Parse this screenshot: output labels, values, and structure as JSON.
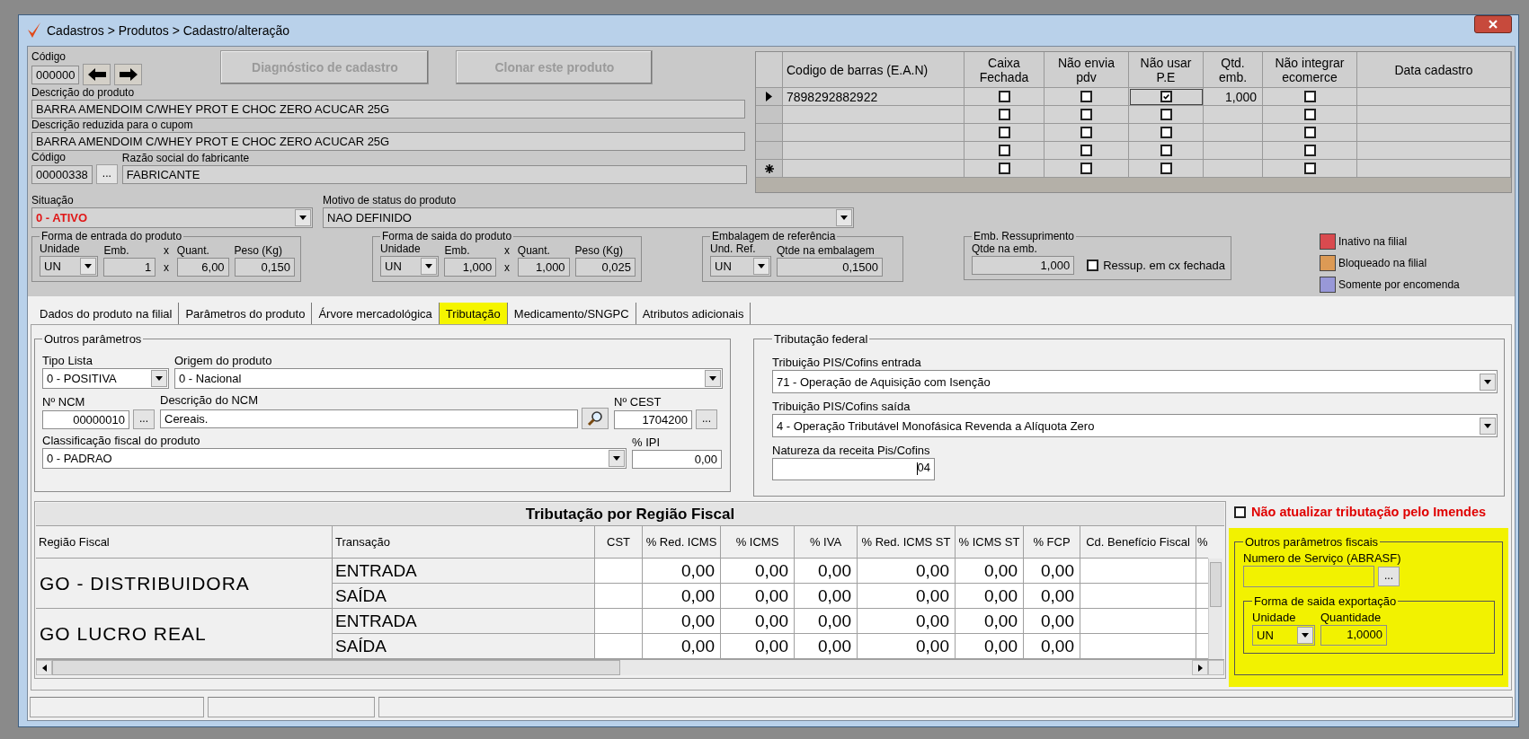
{
  "window": {
    "title": "Cadastros > Produtos > Cadastro/alteração"
  },
  "product": {
    "code": {
      "label": "Código",
      "value": "000000"
    },
    "buttons": [
      {
        "label": "Diagnóstico de cadastro",
        "disabled": true
      },
      {
        "label": "Clonar este produto",
        "disabled": true
      }
    ],
    "description": {
      "label": "Descrição  do produto",
      "value": "BARRA AMENDOIM C/WHEY PROT E CHOC ZERO ACUCAR 25G"
    },
    "short_description": {
      "label": "Descrição reduzida para o cupom",
      "value": "BARRA AMENDOIM C/WHEY PROT E CHOC ZERO ACUCAR 25G"
    },
    "manufacturer_code": {
      "label": "Código",
      "value": "00000338",
      "button": "..."
    },
    "manufacturer_name": {
      "label": "Razão social do fabricante",
      "value": "FABRICANTE"
    },
    "status": {
      "label": "Situação",
      "value": "0 - ATIVO"
    },
    "status_reason": {
      "label": "Motivo de status do produto",
      "value": "NAO DEFINIDO"
    }
  },
  "barcodes": {
    "columns": [
      "Codigo de barras (E.A.N)",
      "Caixa Fechada",
      "Não envia pdv",
      "Não usar P.E",
      "Qtd. emb.",
      "Não integrar ecomerce",
      "Data cadastro"
    ],
    "rows": [
      {
        "kind": "current",
        "ean": "7898292882922",
        "caixa_fechada": false,
        "nao_envia_pdv": false,
        "nao_usar_pe": true,
        "qtd_emb": "1,000",
        "nao_integrar_ecomerce": false
      },
      {
        "kind": "row",
        "caixa_fechada": false,
        "nao_envia_pdv": false,
        "nao_usar_pe": false,
        "nao_integrar_ecomerce": false
      },
      {
        "kind": "row",
        "caixa_fechada": false,
        "nao_envia_pdv": false,
        "nao_usar_pe": false,
        "nao_integrar_ecomerce": false
      },
      {
        "kind": "row",
        "caixa_fechada": false,
        "nao_envia_pdv": false,
        "nao_usar_pe": false,
        "nao_integrar_ecomerce": false
      },
      {
        "kind": "new",
        "caixa_fechada": false,
        "nao_envia_pdv": false,
        "nao_usar_pe": false,
        "nao_integrar_ecomerce": false
      }
    ]
  },
  "packaging_groups": [
    {
      "title": "Forma de entrada do produto",
      "fields": [
        {
          "kind": "combo",
          "label": "Unidade",
          "value": "UN"
        },
        {
          "kind": "text",
          "label": "Emb.",
          "value": "1"
        },
        {
          "kind": "times",
          "label": "x",
          "value": "x"
        },
        {
          "kind": "text",
          "label": "Quant.",
          "value": "6,00"
        },
        {
          "kind": "text",
          "label": "Peso (Kg)",
          "value": "0,150"
        }
      ]
    },
    {
      "title": "Forma de saida do produto",
      "fields": [
        {
          "kind": "combo",
          "label": "Unidade",
          "value": "UN"
        },
        {
          "kind": "text",
          "label": "Emb.",
          "value": "1,000"
        },
        {
          "kind": "times",
          "label": "x",
          "value": "x"
        },
        {
          "kind": "text",
          "label": "Quant.",
          "value": "1,000"
        },
        {
          "kind": "text",
          "label": "Peso (Kg)",
          "value": "0,025"
        }
      ]
    },
    {
      "title": "Embalagem de referência",
      "fields": [
        {
          "kind": "combo",
          "label": "Und. Ref.",
          "value": "UN"
        },
        {
          "kind": "wide",
          "label": "Qtde na embalagem",
          "value": "0,1500"
        }
      ]
    },
    {
      "title": "Emb. Ressuprimento",
      "fields": [
        {
          "kind": "wide",
          "label": "Qtde na emb.",
          "value": "1,000"
        },
        {
          "kind": "checkbox",
          "label": "Ressup. em cx fechada",
          "checked": false
        }
      ]
    }
  ],
  "legend": [
    {
      "label": "Inativo na filial",
      "color": "#d94a4f"
    },
    {
      "label": "Bloqueado na filial",
      "color": "#dc9a55"
    },
    {
      "label": "Somente por encomenda",
      "color": "#9898d8"
    }
  ],
  "tabs": [
    {
      "label": "Dados do produto na filial",
      "selected": false
    },
    {
      "label": "Parâmetros do produto",
      "selected": false
    },
    {
      "label": "Árvore mercadológica",
      "selected": false
    },
    {
      "label": "Tributação",
      "selected": true
    },
    {
      "label": "Medicamento/SNGPC",
      "selected": false
    },
    {
      "label": "Atributos adicionais",
      "selected": false
    }
  ],
  "other_params": {
    "title": "Outros parâmetros",
    "tipo_lista": {
      "label": "Tipo Lista",
      "value": "0 - POSITIVA"
    },
    "origem": {
      "label": "Origem do produto",
      "value": "0 - Nacional"
    },
    "ncm": {
      "label": "Nº NCM",
      "value": "00000010",
      "button": "..."
    },
    "ncm_description": {
      "label": "Descrição do NCM",
      "value": "Cereais."
    },
    "cest": {
      "label": "Nº CEST",
      "value": "1704200",
      "button": "..."
    },
    "classificacao": {
      "label": "Classificação fiscal do produto",
      "value": "0 - PADRAO"
    },
    "ipi": {
      "label": "% IPI",
      "value": "0,00"
    }
  },
  "federal": {
    "title": "Tributação federal",
    "pis_cofins_entrada": {
      "label": "Tribuição PIS/Cofins entrada",
      "value": "71 -  Operação de Aquisição com Isenção"
    },
    "pis_cofins_saida": {
      "label": "Tribuição PIS/Cofins saída",
      "value": "4 -  Operação Tributável Monofásica Revenda a Alíquota Zero"
    },
    "natureza": {
      "label": "Natureza da receita Pis/Cofins",
      "value": "04"
    }
  },
  "regional": {
    "title": "Tributação por Região Fiscal",
    "columns": [
      "Região Fiscal",
      "Transação",
      "CST",
      "% Red. ICMS",
      "% ICMS",
      "% IVA",
      "% Red. ICMS ST",
      "% ICMS ST",
      "% FCP",
      "Cd. Benefício Fiscal",
      "%"
    ],
    "regions": [
      {
        "name": "GO - DISTRIBUIDORA",
        "rows": [
          {
            "transaction": "ENTRADA",
            "values": [
              "0,00",
              "0,00",
              "0,00",
              "0,00",
              "0,00",
              "0,00"
            ]
          },
          {
            "transaction": "SAÍDA",
            "values": [
              "0,00",
              "0,00",
              "0,00",
              "0,00",
              "0,00",
              "0,00"
            ]
          }
        ]
      },
      {
        "name": "GO LUCRO REAL",
        "rows": [
          {
            "transaction": "ENTRADA",
            "values": [
              "0,00",
              "0,00",
              "0,00",
              "0,00",
              "0,00",
              "0,00"
            ]
          },
          {
            "transaction": "SAÍDA",
            "values": [
              "0,00",
              "0,00",
              "0,00",
              "0,00",
              "0,00",
              "0,00"
            ]
          }
        ]
      }
    ]
  },
  "imendes": {
    "label": "Não atualizar tributação pelo Imendes",
    "checked": false
  },
  "fiscal_panel": {
    "highlighted": true,
    "title": "Outros parâmetros fiscais",
    "service_number": {
      "label": "Numero de Serviço (ABRASF)",
      "button": "..."
    },
    "export": {
      "title": "Forma de saida exportação",
      "unit": {
        "label": "Unidade",
        "value": "UN"
      },
      "quantity": {
        "label": "Quantidade",
        "value": "1,0000"
      }
    }
  }
}
